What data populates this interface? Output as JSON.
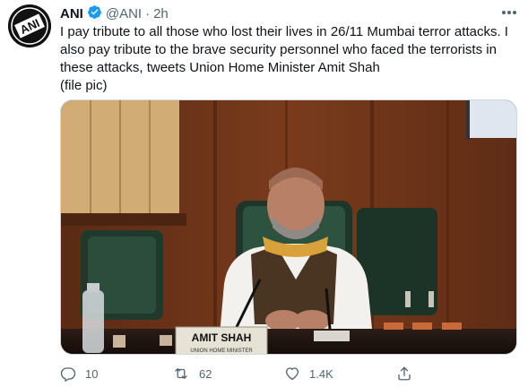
{
  "tweet": {
    "author_name": "ANI",
    "handle": "@ANI",
    "separator": "·",
    "time": "2h",
    "avatar_text": "ANI",
    "text_lines": [
      "I pay tribute to all those who lost their lives in 26/11 Mumbai terror attacks. I",
      "also pay tribute to the brave security personnel who faced the terrorists in",
      "these attacks, tweets Union Home Minister Amit Shah",
      "(file pic)"
    ],
    "photo": {
      "nameplate_name": "AMIT SHAH",
      "nameplate_title": "UNION HOME MINISTER"
    }
  },
  "actions": {
    "reply_count": "10",
    "retweet_count": "62",
    "like_count": "1.4K"
  },
  "icons": {
    "verified": "verified-badge-icon",
    "more": "more-dots-icon",
    "reply": "reply-icon",
    "retweet": "retweet-icon",
    "like": "heart-icon",
    "share": "share-icon"
  },
  "colors": {
    "verified_blue": "#1d9bf0",
    "text": "#0f1419",
    "muted": "#536471"
  }
}
